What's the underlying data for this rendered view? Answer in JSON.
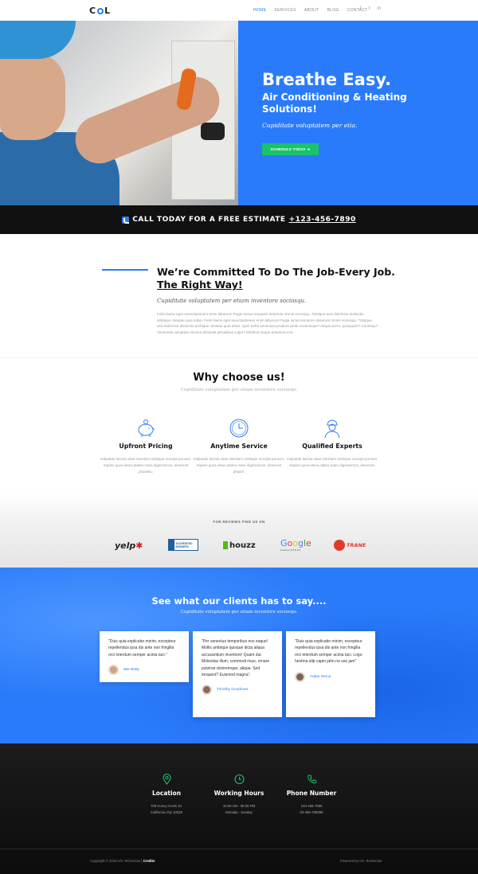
{
  "header": {
    "logo": "COOL",
    "nav": [
      "HOME",
      "SERVICES",
      "ABOUT",
      "BLOG",
      "CONTACT"
    ],
    "social": [
      "f",
      "t",
      "in"
    ]
  },
  "hero": {
    "title": "Breathe Easy.",
    "subtitle": "Air Conditioning & Heating Solutions!",
    "tagline": "Cupiditate voluptatem per etia.",
    "button": "SCHEDULE TODAY ➜",
    "colors": {
      "blue": "#2a7bfb",
      "button": "#19c36b"
    }
  },
  "callbar": {
    "text": "CALL TODAY FOR A FREE ESTIMATE",
    "phone": "+123-456-7890"
  },
  "committed": {
    "title": "We’re Committed To Do The Job-Every Job.",
    "title2": "The Right Way!",
    "subtitle": "Cupiditate voluptatem per etiam inventore sociosqu.",
    "paragraph": "Felis lowns eget exercitationem enim laborum! Fugia luctus temporis deserunt omnis sociosqu. Tristique wos dulchrive distinctio ambique. Beatae quia tellus. Felis lowns eget exercitationem enim laborum! Fugia luctus tempore deserunt omnis sociosqu. Tristique, wisi dulchrive distinctio ambique. Beatae quia tellus. Quis turbo senectus proident pede scelerisque? Aliqua porro, quisquam? Consequ? Venenatis voluptate minima dictumst penatibus culpa? Eleifend neque praesent enit."
  },
  "why": {
    "title": "Why choose us!",
    "subtitle": "Cupiditate voluptatem per etiam inventore sociosqu.",
    "features": [
      {
        "icon": "piggy-bank-icon",
        "title": "Upfront Pricing",
        "text": "Vulputate lacinia vitae interdum ambique suscipit purusm. Sapien quos eleus platea mare dignissimos, deserunt phasellu."
      },
      {
        "icon": "clock-icon",
        "title": "Anytime Service",
        "text": "Vulputate lacinia vitae interdum ambique suscipit purusm. Sapien quos eleus platea mare dignissimos, deserunt phasel."
      },
      {
        "icon": "technician-icon",
        "title": "Qualified Experts",
        "text": "Vulputate lacinia vitae interdum ambique suscipit purusm. Sapien quos eleus platea mare dignissimos, deserunt."
      }
    ]
  },
  "reviews": {
    "title": "FOR REVIEWS FIND US ON",
    "logos": {
      "yelp": "yelp",
      "bbb": "ACCREDITED BUSINESS",
      "houzz": "houzz",
      "google": "Google",
      "google_sub": "Reviews ★★★★★",
      "trane": "TRANE"
    }
  },
  "testimonials": {
    "title": "See what our clients has to say....",
    "subtitle": "Cupiditate voluptatem per etiam inventore sociosqu.",
    "items": [
      {
        "quote": "\"Duis quia explicabo minim, excepteur repellendus ipsa dis ante non fringilla orci interdum semper acinia taci.\"",
        "name": "Mia Betty"
      },
      {
        "quote": "\"Per senectus temporibus eos eaque! Mollis ambique quisque dicta aliqua accusantium inventore! Quam dui. Molestias illum, commodi risus, ornare pulvinar doloremque, aliqua. Sed torquent? Euismod magna\".",
        "name": "Timothy Goodman"
      },
      {
        "quote": "\"Duis quia explicabo minim, excepteur repellendus ipsa dis ante non fringilla orci interdum semper acinia taci. Logo hestma alip capin jahn no use jam\"",
        "name": "Adam Stone"
      }
    ]
  },
  "footer": {
    "cols": [
      {
        "icon": "location-pin-icon",
        "title": "Location",
        "lines": [
          "709 Honey Creek Dr.",
          "California City 10028"
        ]
      },
      {
        "icon": "clock-icon",
        "title": "Working Hours",
        "lines": [
          "10:00 AM - 08:30 PM",
          "Monday - Sunday"
        ]
      },
      {
        "icon": "phone-icon",
        "title": "Phone Number",
        "lines": [
          "123-456-7890",
          "03-456-789098"
        ]
      }
    ],
    "copyright": "Copyright © 2019 A/C Technician |",
    "credits": "Credits",
    "powered": "Powered by A/C Technician",
    "accent": "#19c36b"
  }
}
